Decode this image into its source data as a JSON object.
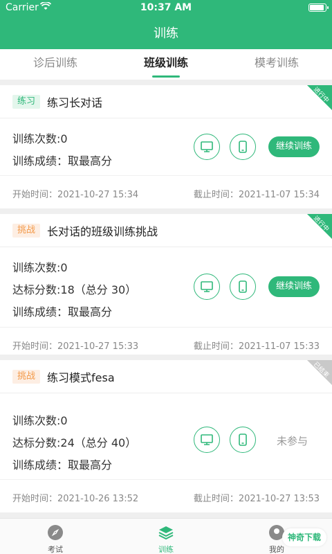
{
  "status_bar": {
    "carrier": "Carrier",
    "time": "10:37 AM"
  },
  "header": {
    "title": "训练"
  },
  "tabs": [
    {
      "label": "诊后训练",
      "active": false
    },
    {
      "label": "班级训练",
      "active": true
    },
    {
      "label": "模考训练",
      "active": false
    }
  ],
  "cards": [
    {
      "badge": "练习",
      "title": "练习长对话",
      "corner": "进行中",
      "info": [
        "训练次数:0",
        "训练成绩：取最高分"
      ],
      "action": "继续训练",
      "start": "开始时间：2021-10-27 15:34",
      "end": "截止时间：2021-11-07 15:34"
    },
    {
      "badge": "挑战",
      "title": "长对话的班级训练挑战",
      "corner": "进行中",
      "info": [
        "训练次数:0",
        "达标分数:18（总分 30）",
        "训练成绩：取最高分"
      ],
      "action": "继续训练",
      "start": "开始时间：2021-10-27 15:33",
      "end": "截止时间：2021-11-07 15:33"
    },
    {
      "badge": "挑战",
      "title": "练习模式fesa",
      "corner": "已结束",
      "info": [
        "训练次数:0",
        "达标分数:24（总分 40）",
        "训练成绩：取最高分"
      ],
      "action": "未参与",
      "start": "开始时间：2021-10-26 13:52",
      "end": "截止时间：2021-10-27 13:53"
    }
  ],
  "bottom_nav": [
    {
      "label": "考试",
      "icon": "compass-icon"
    },
    {
      "label": "训练",
      "icon": "layers-icon",
      "active": true
    },
    {
      "label": "我的",
      "icon": "person-icon"
    }
  ],
  "watermark": "神奇下载",
  "colors": {
    "primary": "#2fb87a",
    "challenge": "#f39a4a",
    "ended": "#c9c9c9"
  }
}
